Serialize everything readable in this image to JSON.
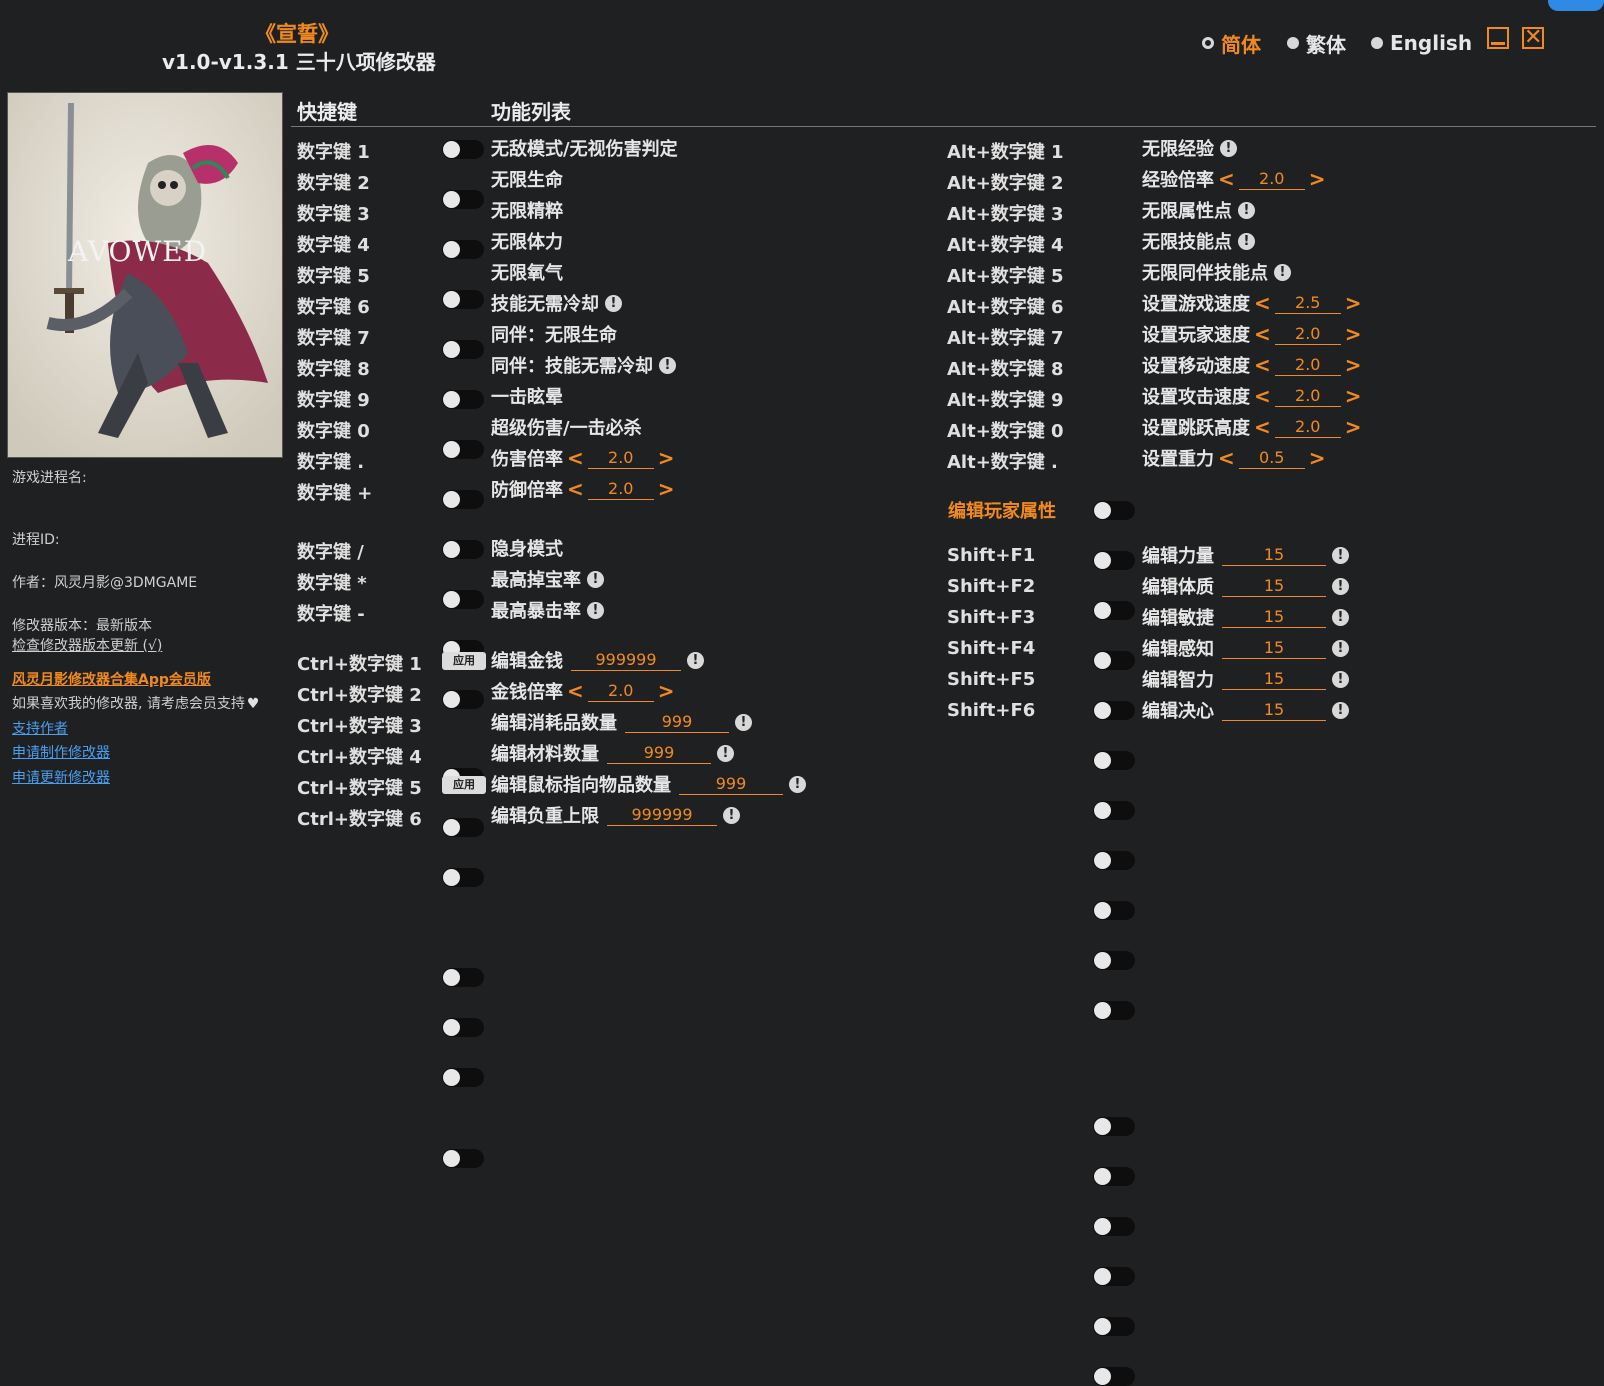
{
  "header": {
    "game_title": "《宣誓》",
    "subtitle": "v1.0-v1.3.1 三十八项修改器",
    "languages": [
      "简体",
      "繁体",
      "English"
    ],
    "selected_language": "简体"
  },
  "cover": {
    "logo_text": "AVOWED"
  },
  "side": {
    "process_name_label": "游戏进程名:",
    "process_id_label": "进程ID:",
    "author": "作者：风灵月影@3DMGAME",
    "version": "修改器版本：最新版本",
    "check_update": "检查修改器版本更新 (√)",
    "app_link": "风灵月影修改器合集App会员版",
    "support_text": "如果喜欢我的修改器, 请考虑会员支持",
    "links": [
      "支持作者",
      "申请制作修改器",
      "申请更新修改器"
    ]
  },
  "columns": {
    "hotkey": "快捷键",
    "features": "功能列表"
  },
  "apply_label": "应用",
  "left_rows": [
    {
      "key": "数字键 1",
      "label": "无敌模式/无视伤害判定"
    },
    {
      "key": "数字键 2",
      "label": "无限生命"
    },
    {
      "key": "数字键 3",
      "label": "无限精粹"
    },
    {
      "key": "数字键 4",
      "label": "无限体力"
    },
    {
      "key": "数字键 5",
      "label": "无限氧气"
    },
    {
      "key": "数字键 6",
      "label": "技能无需冷却",
      "info": true
    },
    {
      "key": "数字键 7",
      "label": "同伴：无限生命"
    },
    {
      "key": "数字键 8",
      "label": "同伴：技能无需冷却",
      "info": true
    },
    {
      "key": "数字键 9",
      "label": "一击眩晕"
    },
    {
      "key": "数字键 0",
      "label": "超级伤害/一击必杀"
    },
    {
      "key": "数字键 .",
      "label": "伤害倍率",
      "stepper": "2.0"
    },
    {
      "key": "数字键 +",
      "label": "防御倍率",
      "stepper": "2.0"
    },
    {
      "key": "数字键 /",
      "label": "隐身模式"
    },
    {
      "key": "数字键 *",
      "label": "最高掉宝率",
      "info": true
    },
    {
      "key": "数字键 -",
      "label": "最高暴击率",
      "info": true
    },
    {
      "key": "Ctrl+数字键 1",
      "label": "编辑金钱",
      "apply": true,
      "input": "999999",
      "info": true
    },
    {
      "key": "Ctrl+数字键 2",
      "label": "金钱倍率",
      "stepper": "2.0"
    },
    {
      "key": "Ctrl+数字键 3",
      "label": "编辑消耗品数量",
      "input": "999",
      "info": true
    },
    {
      "key": "Ctrl+数字键 4",
      "label": "编辑材料数量",
      "input": "999",
      "info": true
    },
    {
      "key": "Ctrl+数字键 5",
      "label": "编辑鼠标指向物品数量",
      "apply": true,
      "input": "999",
      "info": true
    },
    {
      "key": "Ctrl+数字键 6",
      "label": "编辑负重上限",
      "input": "999999",
      "info": true
    }
  ],
  "right_rows": [
    {
      "key": "Alt+数字键 1",
      "label": "无限经验",
      "info": true
    },
    {
      "key": "Alt+数字键 2",
      "label": "经验倍率",
      "stepper": "2.0"
    },
    {
      "key": "Alt+数字键 3",
      "label": "无限属性点",
      "info": true
    },
    {
      "key": "Alt+数字键 4",
      "label": "无限技能点",
      "info": true
    },
    {
      "key": "Alt+数字键 5",
      "label": "无限同伴技能点",
      "info": true
    },
    {
      "key": "Alt+数字键 6",
      "label": "设置游戏速度",
      "stepper": "2.5"
    },
    {
      "key": "Alt+数字键 7",
      "label": "设置玩家速度",
      "stepper": "2.0"
    },
    {
      "key": "Alt+数字键 8",
      "label": "设置移动速度",
      "stepper": "2.0"
    },
    {
      "key": "Alt+数字键 9",
      "label": "设置攻击速度",
      "stepper": "2.0"
    },
    {
      "key": "Alt+数字键 0",
      "label": "设置跳跃高度",
      "stepper": "2.0"
    },
    {
      "key": "Alt+数字键 .",
      "label": "设置重力",
      "stepper": "0.5"
    }
  ],
  "player_section": {
    "title": "编辑玩家属性",
    "rows": [
      {
        "key": "Shift+F1",
        "label": "编辑力量",
        "input": "15",
        "info": true
      },
      {
        "key": "Shift+F2",
        "label": "编辑体质",
        "input": "15",
        "info": true
      },
      {
        "key": "Shift+F3",
        "label": "编辑敏捷",
        "input": "15",
        "info": true
      },
      {
        "key": "Shift+F4",
        "label": "编辑感知",
        "input": "15",
        "info": true
      },
      {
        "key": "Shift+F5",
        "label": "编辑智力",
        "input": "15",
        "info": true
      },
      {
        "key": "Shift+F6",
        "label": "编辑决心",
        "input": "15",
        "info": true
      }
    ]
  },
  "colors": {
    "accent": "#f08a20",
    "background": "#1f2022",
    "link": "#4a9ff0"
  },
  "icons": {
    "info": "exclamation-info-icon",
    "heart": "heart-icon",
    "minimize": "minimize-icon",
    "close": "close-icon"
  }
}
